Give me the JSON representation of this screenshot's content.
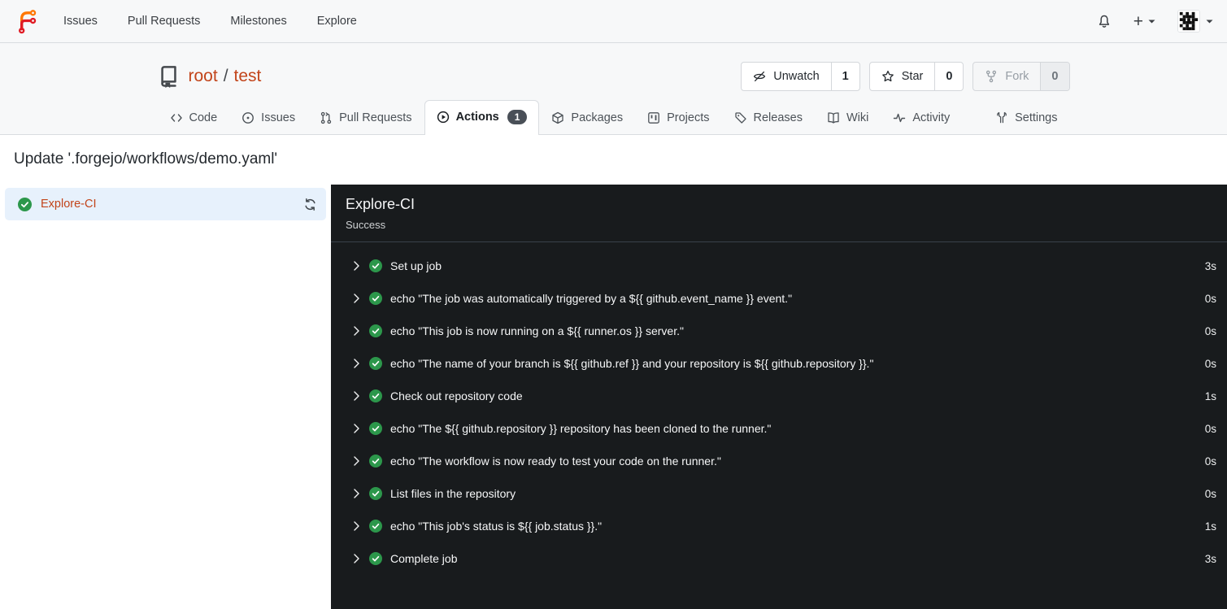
{
  "colors": {
    "primary_link": "#c2441a",
    "success_green": "#2c974b",
    "console_bg": "#181b1d",
    "sidebar_active_bg": "#e7f1fc",
    "badge_bg": "#494f57",
    "header_bg": "#f7f8f9"
  },
  "navbar": {
    "logo_icon": "forgejo-logo",
    "items": [
      {
        "label": "Issues"
      },
      {
        "label": "Pull Requests"
      },
      {
        "label": "Milestones"
      },
      {
        "label": "Explore"
      }
    ],
    "bell_icon": "bell-icon",
    "plus_label": "+",
    "avatar_icon": "identicon-avatar"
  },
  "repo_header": {
    "book_icon": "repo-book-icon",
    "owner": "root",
    "separator": "/",
    "name": "test",
    "watch": {
      "label": "Unwatch",
      "count": "1",
      "icon": "eye-slash-icon"
    },
    "star": {
      "label": "Star",
      "count": "0",
      "icon": "star-icon"
    },
    "fork": {
      "label": "Fork",
      "count": "0",
      "icon": "fork-icon",
      "disabled": true
    }
  },
  "tabs": [
    {
      "label": "Code",
      "icon": "code-icon"
    },
    {
      "label": "Issues",
      "icon": "issue-circle-icon"
    },
    {
      "label": "Pull Requests",
      "icon": "pull-request-icon"
    },
    {
      "label": "Actions",
      "icon": "play-circle-icon",
      "badge": "1",
      "active": true
    },
    {
      "label": "Packages",
      "icon": "package-cube-icon"
    },
    {
      "label": "Projects",
      "icon": "project-board-icon"
    },
    {
      "label": "Releases",
      "icon": "tag-icon"
    },
    {
      "label": "Wiki",
      "icon": "book-open-icon"
    },
    {
      "label": "Activity",
      "icon": "pulse-icon"
    },
    {
      "label": "Settings",
      "icon": "tools-icon"
    }
  ],
  "page": {
    "title": "Update '.forgejo/workflows/demo.yaml'"
  },
  "sidebar": {
    "job": {
      "name": "Explore-CI",
      "status_icon": "success-check-icon",
      "refresh_icon": "sync-icon"
    }
  },
  "run_panel": {
    "title": "Explore-CI",
    "status": "Success",
    "steps": [
      {
        "name": "Set up job",
        "duration": "3s"
      },
      {
        "name": "echo \"The job was automatically triggered by a ${{ github.event_name }} event.\"",
        "duration": "0s"
      },
      {
        "name": "echo \"This job is now running on a ${{ runner.os }} server.\"",
        "duration": "0s"
      },
      {
        "name": "echo \"The name of your branch is ${{ github.ref }} and your repository is ${{ github.repository }}.\"",
        "duration": "0s"
      },
      {
        "name": "Check out repository code",
        "duration": "1s"
      },
      {
        "name": "echo \"The ${{ github.repository }} repository has been cloned to the runner.\"",
        "duration": "0s"
      },
      {
        "name": "echo \"The workflow is now ready to test your code on the runner.\"",
        "duration": "0s"
      },
      {
        "name": "List files in the repository",
        "duration": "0s"
      },
      {
        "name": "echo \"This job's status is ${{ job.status }}.\"",
        "duration": "1s"
      },
      {
        "name": "Complete job",
        "duration": "3s"
      }
    ]
  }
}
